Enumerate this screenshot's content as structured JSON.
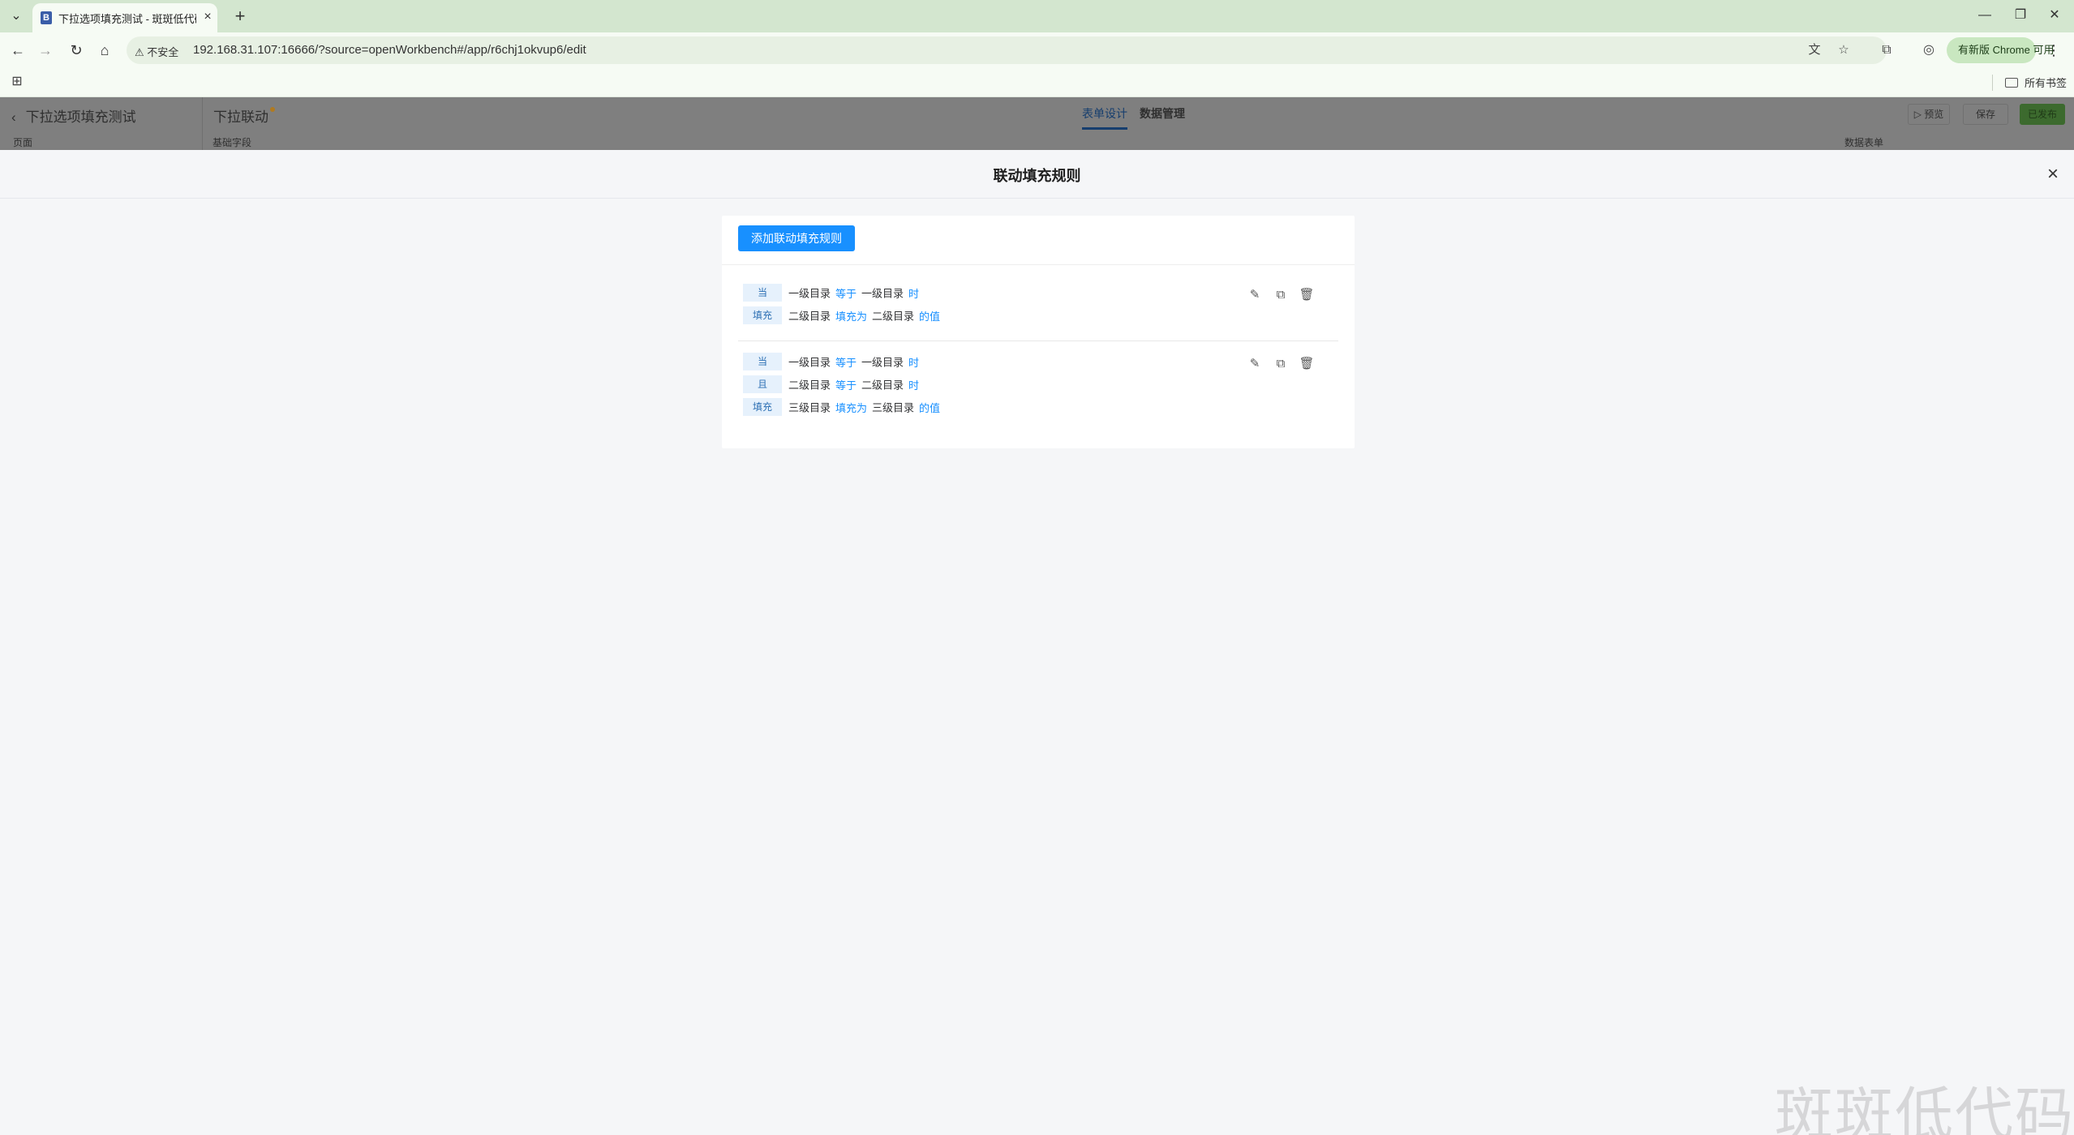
{
  "browser": {
    "tab_title": "下拉选项填充测试 - 斑斑低代码",
    "tab_close": "×",
    "new_tab": "+",
    "security_label": "⚠ 不安全",
    "url": "192.168.31.107:16666/?source=openWorkbench#/app/r6chj1okvup6/edit",
    "update_label": "有新版 Chrome 可用",
    "bookmarks_all": "所有书签",
    "window_controls": [
      "—",
      "❐",
      "✕"
    ]
  },
  "app_header": {
    "back_label": "下拉选项填充测试",
    "form_name": "下拉联动",
    "tabs": [
      {
        "label": "表单设计",
        "active": true
      },
      {
        "label": "数据管理",
        "active": false
      }
    ],
    "preview_label": "▷ 预览",
    "save_label": "保存",
    "publish_label": "已发布",
    "left_panel_label": "页面",
    "field_panel_label": "基础字段",
    "right_panel_label": "数据表单"
  },
  "drawer": {
    "title": "联动填充规则",
    "close": "×",
    "add_button": "添加联动填充规则",
    "rules": [
      {
        "lines": [
          {
            "tag": "当",
            "field": "一级目录",
            "op": "等于",
            "value": "一级目录",
            "suffix": "时"
          },
          {
            "tag": "填充",
            "field": "二级目录",
            "op": "填充为",
            "value": "二级目录",
            "suffix": "的值"
          }
        ]
      },
      {
        "lines": [
          {
            "tag": "当",
            "field": "一级目录",
            "op": "等于",
            "value": "一级目录",
            "suffix": "时"
          },
          {
            "tag": "且",
            "field": "二级目录",
            "op": "等于",
            "value": "二级目录",
            "suffix": "时"
          },
          {
            "tag": "填充",
            "field": "三级目录",
            "op": "填充为",
            "value": "三级目录",
            "suffix": "的值"
          }
        ]
      }
    ]
  },
  "watermark": "斑斑低代码",
  "colors": {
    "primary": "#1890ff",
    "tag_bg": "#e6f1fc",
    "tag_text": "#2c6fb3"
  }
}
